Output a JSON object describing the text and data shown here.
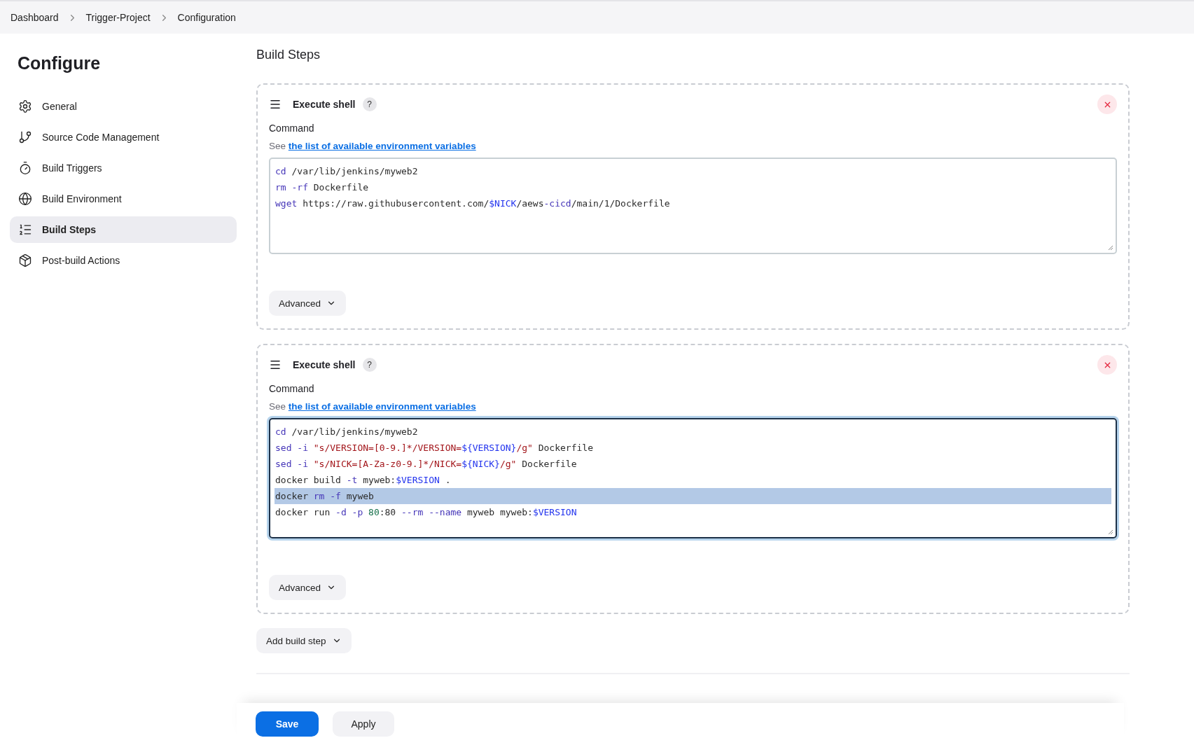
{
  "breadcrumbs": [
    "Dashboard",
    "Trigger-Project",
    "Configuration"
  ],
  "sidebar": {
    "title": "Configure",
    "items": [
      {
        "label": "General",
        "selected": false
      },
      {
        "label": "Source Code Management",
        "selected": false
      },
      {
        "label": "Build Triggers",
        "selected": false
      },
      {
        "label": "Build Environment",
        "selected": false
      },
      {
        "label": "Build Steps",
        "selected": true
      },
      {
        "label": "Post-build Actions",
        "selected": false
      }
    ]
  },
  "section_title": "Build Steps",
  "steps": [
    {
      "title": "Execute shell",
      "help": "?",
      "field_label": "Command",
      "hint_prefix": "See",
      "hint_link": "the list of available environment variables",
      "focused": false,
      "advanced": "Advanced",
      "lines": [
        {
          "selected": false,
          "tokens": [
            {
              "text": "cd",
              "kind": "keyword"
            },
            {
              "text": " /var/lib/jenkins/myweb2",
              "kind": "plain"
            }
          ]
        },
        {
          "selected": false,
          "tokens": [
            {
              "text": "rm ",
              "kind": "keyword"
            },
            {
              "text": "-rf",
              "kind": "keyword"
            },
            {
              "text": " Dockerfile",
              "kind": "plain"
            }
          ]
        },
        {
          "selected": false,
          "tokens": [
            {
              "text": "wget",
              "kind": "keyword"
            },
            {
              "text": " https://raw.githubusercontent.com/",
              "kind": "plain"
            },
            {
              "text": "$NICK",
              "kind": "variable"
            },
            {
              "text": "/aews",
              "kind": "plain"
            },
            {
              "text": "-cicd",
              "kind": "keyword"
            },
            {
              "text": "/main/1/Dockerfile",
              "kind": "plain"
            }
          ]
        }
      ]
    },
    {
      "title": "Execute shell",
      "help": "?",
      "field_label": "Command",
      "hint_prefix": "See",
      "hint_link": "the list of available environment variables",
      "focused": true,
      "advanced": "Advanced",
      "lines": [
        {
          "selected": false,
          "tokens": [
            {
              "text": "cd",
              "kind": "keyword"
            },
            {
              "text": " /var/lib/jenkins/myweb2",
              "kind": "plain"
            }
          ]
        },
        {
          "selected": false,
          "tokens": [
            {
              "text": "sed ",
              "kind": "keyword"
            },
            {
              "text": "-i ",
              "kind": "keyword"
            },
            {
              "text": "\"s/VERSION=[0-9.]*/VERSION=",
              "kind": "string"
            },
            {
              "text": "${VERSION}",
              "kind": "variable"
            },
            {
              "text": "/g\"",
              "kind": "string"
            },
            {
              "text": " Dockerfile",
              "kind": "plain"
            }
          ]
        },
        {
          "selected": false,
          "tokens": [
            {
              "text": "sed ",
              "kind": "keyword"
            },
            {
              "text": "-i ",
              "kind": "keyword"
            },
            {
              "text": "\"s/NICK=[A-Za-z0-9.]*/NICK=",
              "kind": "string"
            },
            {
              "text": "${NICK}",
              "kind": "variable"
            },
            {
              "text": "/g\"",
              "kind": "string"
            },
            {
              "text": " Dockerfile",
              "kind": "plain"
            }
          ]
        },
        {
          "selected": false,
          "tokens": [
            {
              "text": "docker build ",
              "kind": "plain"
            },
            {
              "text": "-t",
              "kind": "keyword"
            },
            {
              "text": " myweb:",
              "kind": "plain"
            },
            {
              "text": "$VERSION",
              "kind": "variable"
            },
            {
              "text": " .",
              "kind": "plain"
            }
          ]
        },
        {
          "selected": true,
          "tokens": [
            {
              "text": "docker ",
              "kind": "plain"
            },
            {
              "text": "rm ",
              "kind": "keyword"
            },
            {
              "text": "-f",
              "kind": "keyword"
            },
            {
              "text": " myweb",
              "kind": "plain"
            }
          ]
        },
        {
          "selected": false,
          "tokens": [
            {
              "text": "docker run ",
              "kind": "plain"
            },
            {
              "text": "-d ",
              "kind": "keyword"
            },
            {
              "text": "-p ",
              "kind": "keyword"
            },
            {
              "text": "80",
              "kind": "number"
            },
            {
              "text": ":80 ",
              "kind": "plain"
            },
            {
              "text": "--rm ",
              "kind": "keyword"
            },
            {
              "text": "--name",
              "kind": "keyword"
            },
            {
              "text": " myweb myweb:",
              "kind": "plain"
            },
            {
              "text": "$VERSION",
              "kind": "variable"
            }
          ]
        }
      ]
    }
  ],
  "add_step": "Add build step",
  "buttons": [
    {
      "label": "Save",
      "kind": "primary"
    },
    {
      "label": "Apply",
      "kind": "secondary"
    }
  ]
}
